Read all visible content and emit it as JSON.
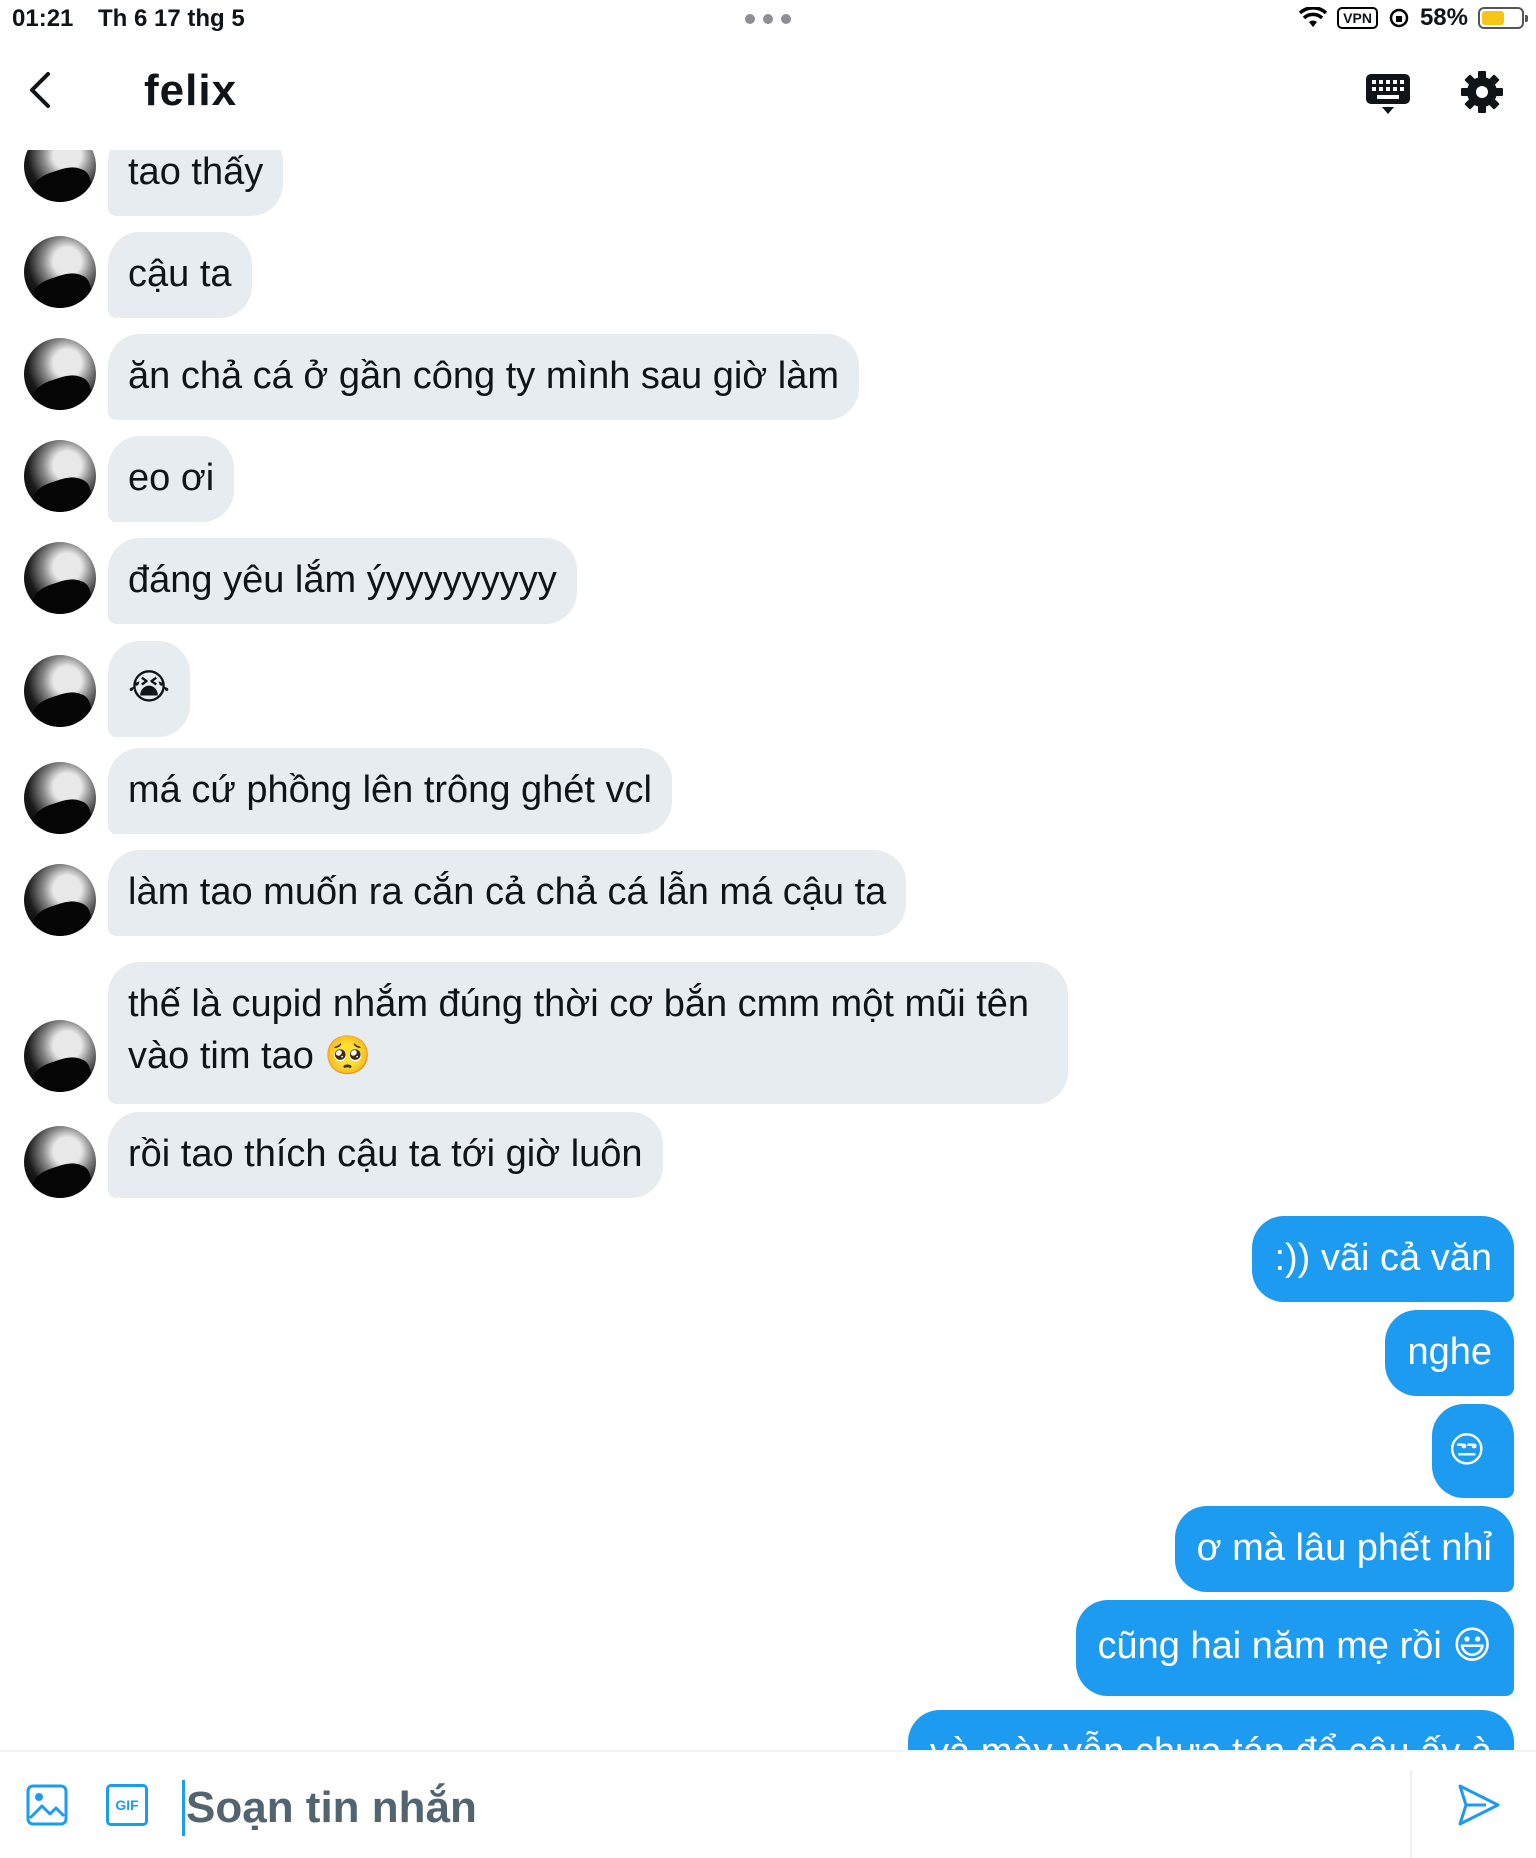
{
  "status_bar": {
    "time": "01:21",
    "date": "Th 6 17 thg 5",
    "vpn": "VPN",
    "battery_text": "58%",
    "battery_level": 0.58
  },
  "header": {
    "title": "felix"
  },
  "messages_in": [
    "tao thấy",
    "cậu ta",
    "ăn chả cá ở gần công ty mình sau giờ làm",
    "eo ơi",
    "đáng yêu lắm ýyyyyyyyyy",
    "😭",
    "má cứ phồng lên trông ghét vcl",
    "làm tao muốn ra cắn cả chả cá lẫn má cậu ta",
    "thế là cupid nhắm đúng thời cơ bắn cmm một mũi tên vào tim tao 🥺",
    "rồi tao thích cậu ta tới giờ luôn"
  ],
  "messages_out": [
    ":)) vãi cả văn",
    "nghe",
    "😒",
    "ơ mà lâu phết nhỉ",
    "cũng hai năm mẹ rồi 😃",
    "và mày vẫn chưa tán đổ cậu ấy à"
  ],
  "composer": {
    "placeholder": "Soạn tin nhắn",
    "gif_label": "GIF"
  },
  "colors": {
    "accent": "#1d9bf0",
    "incoming_bubble": "#e7ecf0",
    "text": "#0f1419"
  },
  "icons": [
    "back-arrow-icon",
    "keyboard-icon",
    "gear-icon",
    "image-icon",
    "gif-icon",
    "send-icon"
  ]
}
